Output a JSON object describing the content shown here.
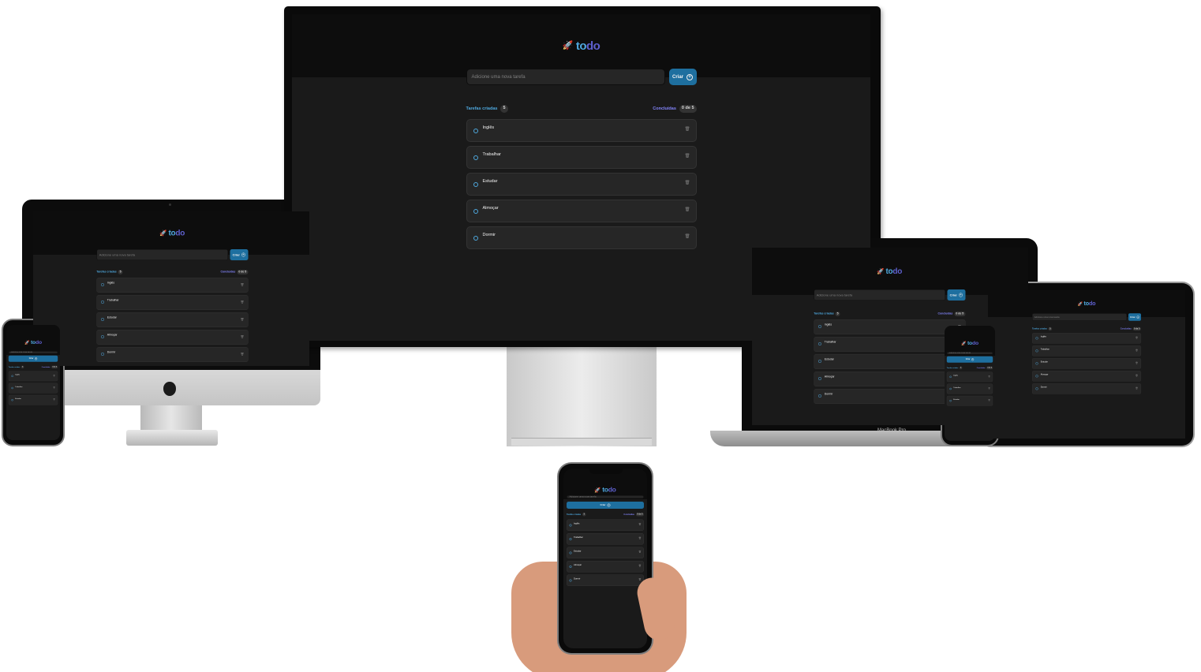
{
  "app": {
    "logo_icon": "🚀",
    "logo_to": "to",
    "logo_do": "do",
    "input_placeholder": "Adicione uma nova tarefa",
    "create_label": "Criar",
    "create_icon": "+",
    "created_label": "Tarefas criadas",
    "created_count": "5",
    "done_label": "Concluídas",
    "done_count": "0 de 5",
    "trash_icon": "🗑",
    "tasks": [
      {
        "text": "Inglês"
      },
      {
        "text": "Trabalhar"
      },
      {
        "text": "Estudar"
      },
      {
        "text": "Almoçar"
      },
      {
        "text": "Dormir"
      }
    ]
  },
  "devices": {
    "laptop_brand": "MacBook Pro"
  },
  "colors": {
    "blue": "#4ea8de",
    "purple": "#5e60ce",
    "button": "#1e6f9f",
    "background": "#1a1a1a",
    "header": "#0d0d0d"
  }
}
